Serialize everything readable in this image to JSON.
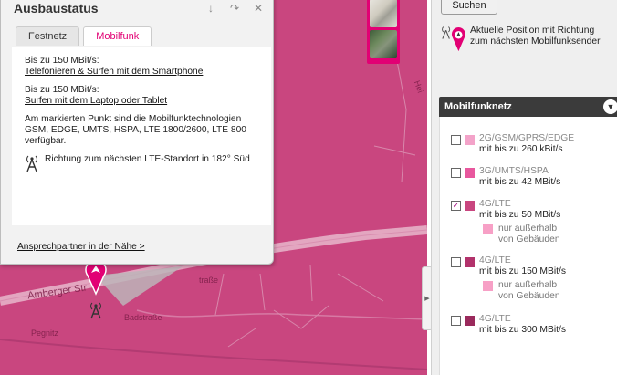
{
  "popup": {
    "title": "Ausbaustatus",
    "tabs": [
      {
        "label": "Festnetz",
        "active": false
      },
      {
        "label": "Mobilfunk",
        "active": true
      }
    ],
    "block1": {
      "line": "Bis zu 150 MBit/s:",
      "link": "Telefonieren & Surfen mit dem Smartphone"
    },
    "block2": {
      "line": "Bis zu 150 MBit/s:",
      "link": "Surfen mit dem Laptop oder Tablet"
    },
    "tech_text": "Am markierten Punkt sind die Mobilfunktechnologien GSM, EDGE, UMTS, HSPA, LTE 1800/2600, LTE 800 verfügbar.",
    "direction_text": "Richtung zum nächsten LTE-Standort in 182° Süd",
    "footer_link": "Ansprechpartner in der Nähe >"
  },
  "map": {
    "street_labels": [
      "Amberger Str",
      "Badstraße",
      "Pegnitz",
      "traße",
      "Hei"
    ],
    "colors": {
      "coverage": "#c9467f",
      "road": "#e6b2c8",
      "marker": "#e20074"
    }
  },
  "sidebar": {
    "search_label": "Suchen",
    "position_legend": "Aktuelle Position mit Richtung zum nächsten Mobilfunksender",
    "panel_title": "Mobilfunknetz",
    "networks": [
      {
        "name": "2G/GSM/GPRS/EDGE",
        "speed": "mit bis zu 260 kBit/s",
        "checked": false,
        "color": "#f3a3c9"
      },
      {
        "name": "3G/UMTS/HSPA",
        "speed": "mit bis zu 42 MBit/s",
        "checked": false,
        "color": "#e8589e"
      },
      {
        "name": "4G/LTE",
        "speed": "mit bis zu 50 MBit/s",
        "checked": true,
        "color": "#c9467f",
        "sub": "nur außerhalb von Gebäuden"
      },
      {
        "name": "4G/LTE",
        "speed": "mit bis zu 150 MBit/s",
        "checked": false,
        "color": "#b2326b",
        "sub": "nur außerhalb von Gebäuden"
      },
      {
        "name": "4G/LTE",
        "speed": "mit bis zu 300 MBit/s",
        "checked": false,
        "color": "#9a2a5c"
      }
    ]
  }
}
